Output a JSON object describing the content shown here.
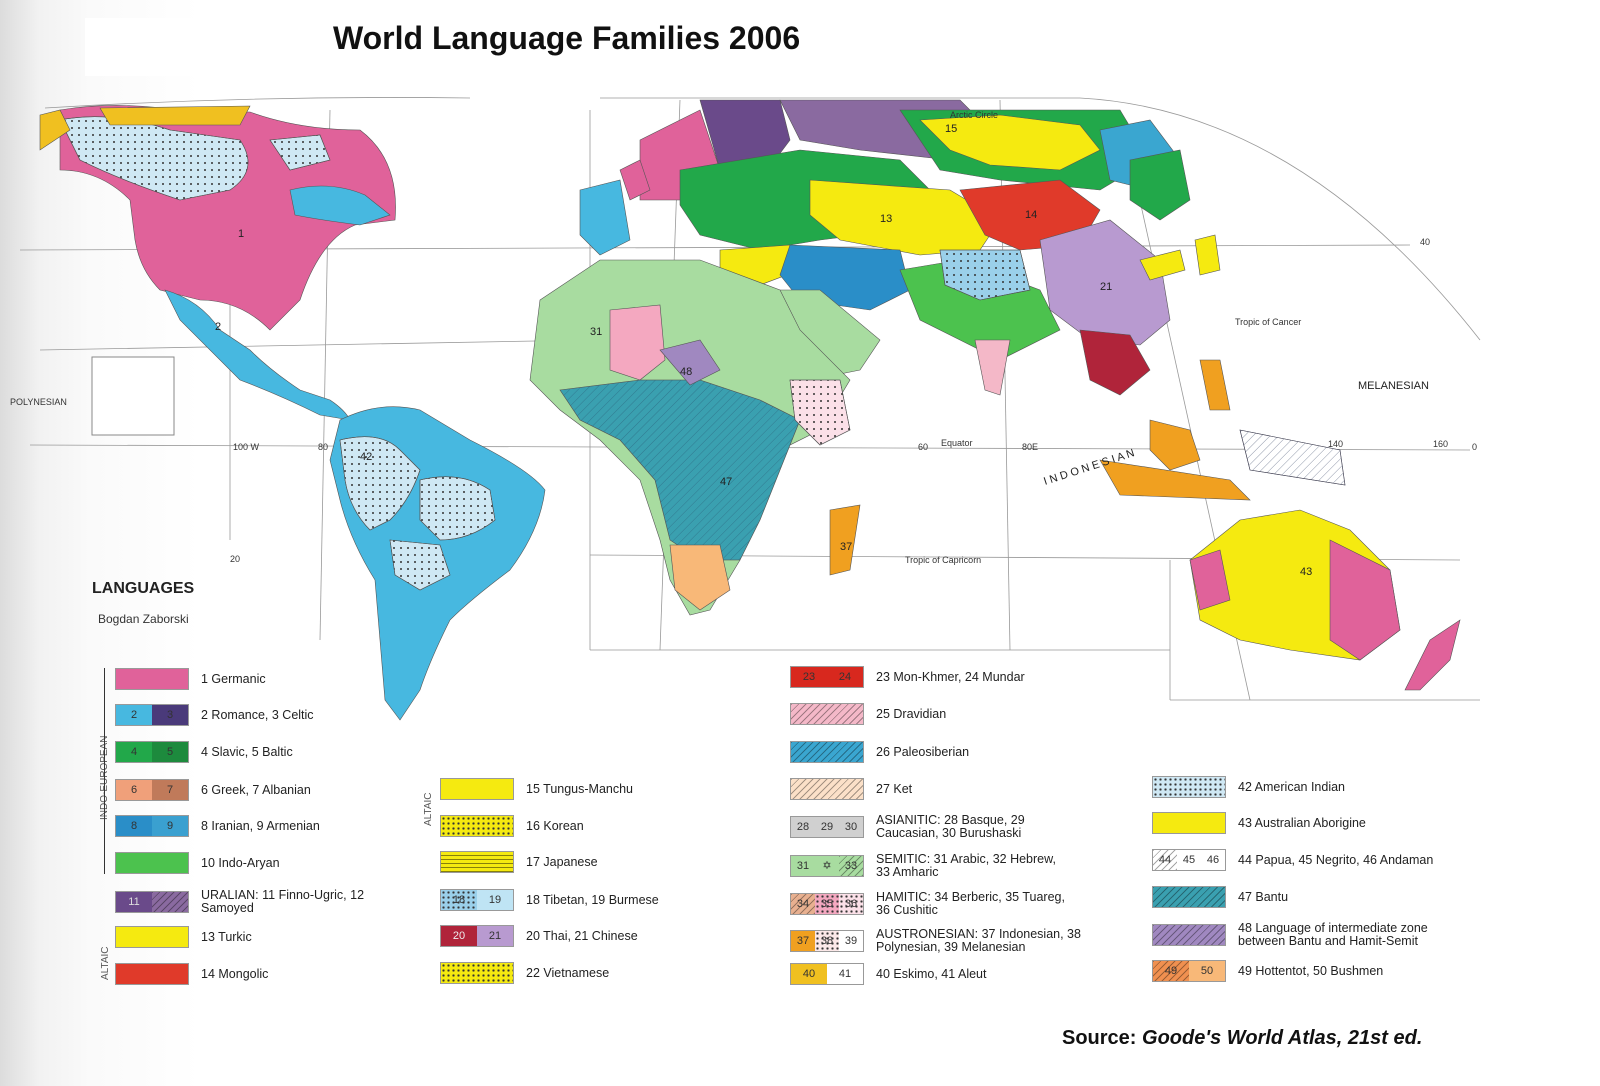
{
  "title": "World Language Families 2006",
  "source_label": "Source:",
  "source_work": "Goode's World Atlas, 21st ed.",
  "legend": {
    "heading": "LANGUAGES",
    "author": "Bogdan Zaborski",
    "group_indo_european": "INDO-EUROPEAN",
    "group_altaic_left": "ALTAIC",
    "group_altaic_mid": "ALTAIC",
    "col1": [
      {
        "label": "1 Germanic",
        "swatch": [
          "",
          ""
        ],
        "colors": [
          "#e0629a"
        ]
      },
      {
        "label": "2 Romance, 3 Celtic",
        "swatch": [
          "2",
          "3"
        ],
        "colors": [
          "#47b8e0",
          "#4a3a7a"
        ]
      },
      {
        "label": "4 Slavic, 5 Baltic",
        "swatch": [
          "4",
          "5"
        ],
        "colors": [
          "#22a84a",
          "#1d8a3d"
        ]
      },
      {
        "label": "6 Greek, 7 Albanian",
        "swatch": [
          "6",
          "7"
        ],
        "colors": [
          "#f0a07a",
          "#c07a5a"
        ]
      },
      {
        "label": "8 Iranian, 9 Armenian",
        "swatch": [
          "8",
          "9"
        ],
        "colors": [
          "#2a8ec8",
          "#3aa0d0"
        ]
      },
      {
        "label": "10 Indo-Aryan",
        "swatch": [
          "",
          ""
        ],
        "colors": [
          "#4cc24e"
        ]
      },
      {
        "label": "URALIAN: 11 Finno-Ugric, 12 Samoyed",
        "swatch": [
          "11",
          ""
        ],
        "colors": [
          "#6a4a8a",
          "#8a6aa0"
        ]
      },
      {
        "label": "13 Turkic",
        "swatch": [
          "",
          ""
        ],
        "colors": [
          "#f5ea10"
        ]
      },
      {
        "label": "14 Mongolic",
        "swatch": [
          "",
          ""
        ],
        "colors": [
          "#e03a2a"
        ]
      }
    ],
    "col2": [
      {
        "label": "15 Tungus-Manchu",
        "swatch": [
          "",
          ""
        ],
        "colors": [
          "#f5ea10"
        ]
      },
      {
        "label": "16 Korean",
        "swatch": [
          "",
          ""
        ],
        "colors": [
          "#f5ea10"
        ]
      },
      {
        "label": "17 Japanese",
        "swatch": [
          "",
          ""
        ],
        "colors": [
          "#f5ea10"
        ]
      },
      {
        "label": "18 Tibetan, 19 Burmese",
        "swatch": [
          "18",
          "19"
        ],
        "colors": [
          "#9ad0ea",
          "#bfe4f4"
        ]
      },
      {
        "label": "20 Thai, 21 Chinese",
        "swatch": [
          "20",
          "21"
        ],
        "colors": [
          "#b0243a",
          "#b89ad0"
        ]
      },
      {
        "label": "22 Vietnamese",
        "swatch": [
          "",
          ""
        ],
        "colors": [
          "#f5ea10"
        ]
      }
    ],
    "col3": [
      {
        "label": "23 Mon-Khmer, 24 Mundar",
        "swatch": [
          "23",
          "24"
        ],
        "colors": [
          "#d8281e",
          "#d8281e"
        ]
      },
      {
        "label": "25 Dravidian",
        "swatch": [
          "",
          ""
        ],
        "colors": [
          "#f4b8c8"
        ]
      },
      {
        "label": "26 Paleosiberian",
        "swatch": [
          "",
          ""
        ],
        "colors": [
          "#3aa6d0"
        ]
      },
      {
        "label": "27 Ket",
        "swatch": [
          "",
          ""
        ],
        "colors": [
          "#fbe0c8"
        ]
      },
      {
        "label": "ASIANITIC: 28 Basque, 29 Caucasian, 30 Burushaski",
        "swatch": [
          "28",
          "29",
          "30"
        ],
        "colors": [
          "#d0d0d0",
          "#d0d0d0",
          "#d0d0d0"
        ]
      },
      {
        "label": "SEMITIC: 31 Arabic, 32 Hebrew, 33 Amharic",
        "swatch": [
          "31",
          "✡",
          "33"
        ],
        "colors": [
          "#a8dca0",
          "#a8dca0",
          "#a8dca0"
        ]
      },
      {
        "label": "HAMITIC: 34 Berberic, 35 Tuareg, 36 Cushitic",
        "swatch": [
          "34",
          "35",
          "36"
        ],
        "colors": [
          "#e8b090",
          "#f4a8c0",
          "#fbe0e8"
        ]
      },
      {
        "label": "AUSTRONESIAN: 37 Indonesian, 38 Polynesian, 39 Melanesian",
        "swatch": [
          "37",
          "38",
          "39"
        ],
        "colors": [
          "#f0a020",
          "#fbe8e8",
          "#ffffff"
        ]
      },
      {
        "label": "40 Eskimo, 41 Aleut",
        "swatch": [
          "40",
          "41"
        ],
        "colors": [
          "#f0c020",
          "#ffffff"
        ]
      }
    ],
    "col4": [
      {
        "label": "42 American Indian",
        "swatch": [
          "",
          ""
        ],
        "colors": [
          "#cfe8f4"
        ]
      },
      {
        "label": "43 Australian Aborigine",
        "swatch": [
          "",
          ""
        ],
        "colors": [
          "#f5ea10"
        ]
      },
      {
        "label": "44 Papua, 45 Negrito, 46 Andaman",
        "swatch": [
          "44",
          "45",
          "46"
        ],
        "colors": [
          "#ffffff",
          "#ffffff",
          "#ffffff"
        ]
      },
      {
        "label": "47 Bantu",
        "swatch": [
          "",
          ""
        ],
        "colors": [
          "#3aa0b0"
        ]
      },
      {
        "label": "48 Language of intermediate zone between Bantu and Hamit-Semit",
        "swatch": [
          "",
          ""
        ],
        "colors": [
          "#a088c0"
        ]
      },
      {
        "label": "49 Hottentot, 50 Bushmen",
        "swatch": [
          "49",
          "50"
        ],
        "colors": [
          "#f09050",
          "#f8b878"
        ]
      }
    ]
  },
  "map_text": {
    "arctic_circle": "Arctic Circle",
    "tropic_cancer": "Tropic of Cancer",
    "tropic_capricorn": "Tropic of Capricorn",
    "equator": "Equator",
    "melanesian": "MELANESIAN",
    "polynesian": "POLYNESIAN",
    "indonesian_arc": "I N D O N E S I A N",
    "lon_100w": "100 W",
    "lon_80": "80",
    "lon_60": "60",
    "lon_80e": "80E",
    "lon_140": "140",
    "lon_160": "160",
    "lat_40": "40",
    "lat_20": "20",
    "lat_0": "0"
  },
  "region_numbers": [
    "1",
    "2",
    "13",
    "14",
    "15",
    "21",
    "31",
    "37",
    "42",
    "43",
    "47",
    "48"
  ]
}
